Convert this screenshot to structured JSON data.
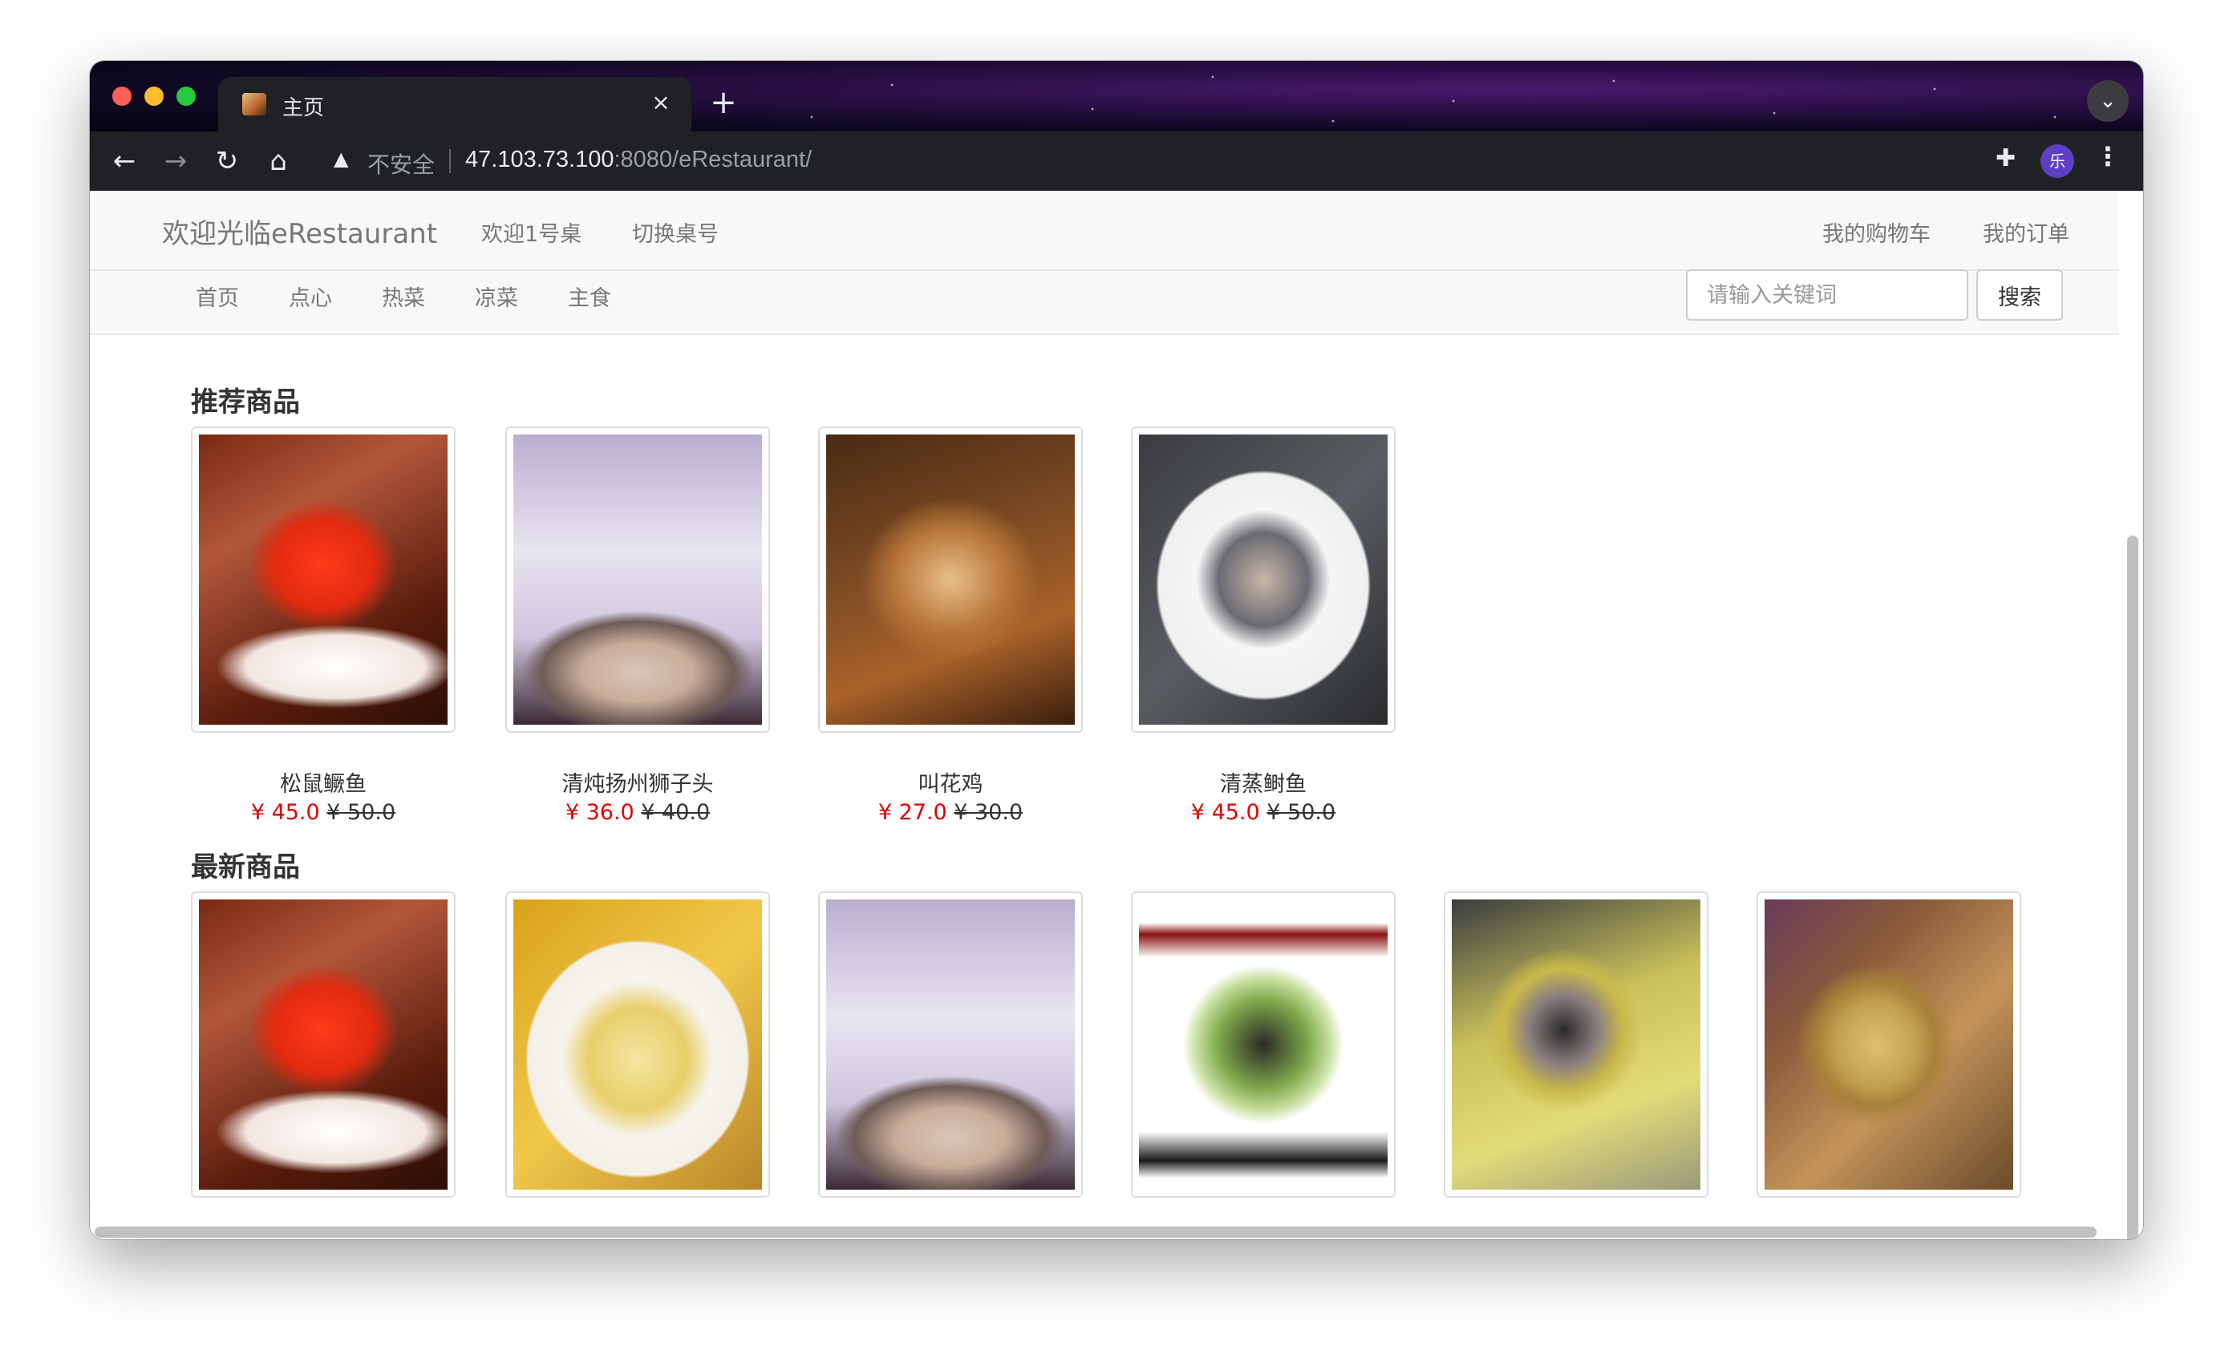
{
  "browser": {
    "tab_title": "主页",
    "tab_close": "×",
    "new_tab": "+",
    "omnibox_warning_icon": "warning-triangle-icon",
    "omnibox_insecure_label": "不安全",
    "url_host": "47.103.73.100",
    "url_rest": ":8080/eRestaurant/",
    "profile_initial": "乐"
  },
  "header": {
    "brand": "欢迎光临eRestaurant",
    "welcome": "欢迎1号桌",
    "switch_table": "切换桌号",
    "cart": "我的购物车",
    "orders": "我的订单"
  },
  "categories": [
    "首页",
    "点心",
    "热菜",
    "凉菜",
    "主食"
  ],
  "search": {
    "placeholder": "请输入关键词",
    "button": "搜索"
  },
  "recommended": {
    "title": "推荐商品",
    "items": [
      {
        "name": "松鼠鳜鱼",
        "price": "¥ 45.0",
        "original": "¥ 50.0",
        "image": "squirrel-fish"
      },
      {
        "name": "清炖扬州狮子头",
        "price": "¥ 36.0",
        "original": "¥ 40.0",
        "image": "lion-head"
      },
      {
        "name": "叫花鸡",
        "price": "¥ 27.0",
        "original": "¥ 30.0",
        "image": "beggars-chicken"
      },
      {
        "name": "清蒸鲥鱼",
        "price": "¥ 45.0",
        "original": "¥ 50.0",
        "image": "steamed-fish"
      }
    ]
  },
  "newest": {
    "title": "最新商品",
    "items": [
      {
        "image": "squirrel-fish"
      },
      {
        "image": "fried-rice"
      },
      {
        "image": "lion-head"
      },
      {
        "image": "vegetables"
      },
      {
        "image": "clam-soup"
      },
      {
        "image": "clay-pot-balls"
      }
    ]
  },
  "colors": {
    "price_red": "#e00000",
    "navbar_bg": "#f8f8f8",
    "chrome_dark": "#202124"
  }
}
